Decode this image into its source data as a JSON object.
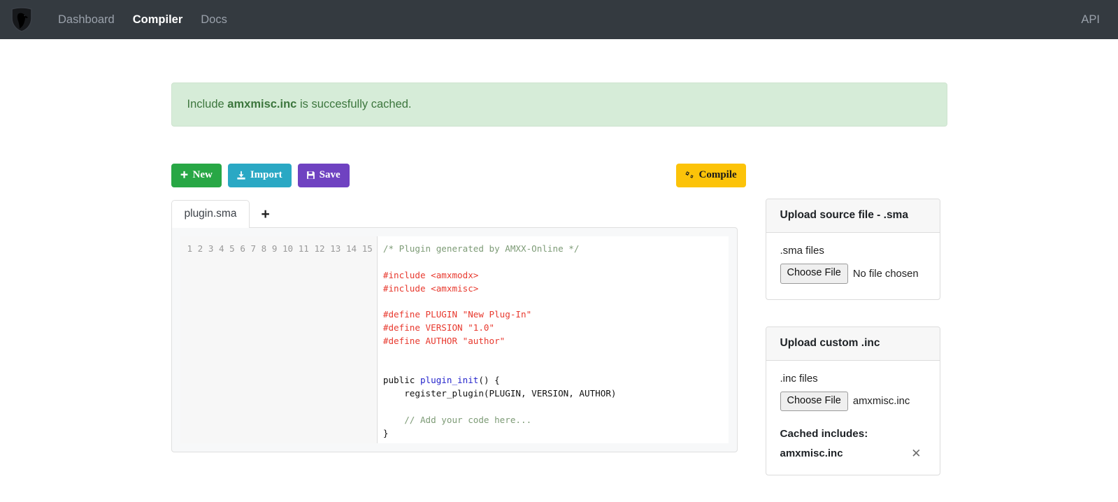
{
  "navbar": {
    "logo_name": "shield-horse-logo",
    "links": [
      {
        "label": "Dashboard",
        "active": false
      },
      {
        "label": "Compiler",
        "active": true
      },
      {
        "label": "Docs",
        "active": false
      }
    ],
    "right_link": "API"
  },
  "alert": {
    "prefix": "Include ",
    "strong": "amxmisc.inc",
    "suffix": " is succesfully cached.",
    "bg_color": "#d6ecd8",
    "text_color": "#3c763d"
  },
  "toolbar": {
    "new_label": "New",
    "import_label": "Import",
    "save_label": "Save",
    "compile_label": "Compile",
    "new_color": "#28a745",
    "import_color": "#2aa8c4",
    "save_color": "#6f42c1",
    "compile_color": "#fcc309"
  },
  "editor": {
    "tabs": [
      {
        "label": "plugin.sma",
        "active": true
      }
    ],
    "add_tab_label": "+",
    "line_numbers": "1\n2\n3\n4\n5\n6\n7\n8\n9\n10\n11\n12\n13\n14\n15",
    "lines": [
      {
        "n": 1,
        "text": "/* Plugin generated by AMXX-Online */",
        "type": "comment"
      },
      {
        "n": 2,
        "text": "",
        "type": "plain"
      },
      {
        "n": 3,
        "text": "#include <amxmodx>",
        "type": "meta"
      },
      {
        "n": 4,
        "text": "#include <amxmisc>",
        "type": "meta"
      },
      {
        "n": 5,
        "text": "",
        "type": "plain"
      },
      {
        "n": 6,
        "text": "#define PLUGIN \"New Plug-In\"",
        "type": "meta"
      },
      {
        "n": 7,
        "text": "#define VERSION \"1.0\"",
        "type": "meta"
      },
      {
        "n": 8,
        "text": "#define AUTHOR \"author\"",
        "type": "meta"
      },
      {
        "n": 9,
        "text": "",
        "type": "plain"
      },
      {
        "n": 10,
        "text": "",
        "type": "plain"
      },
      {
        "n": 11,
        "text": "public plugin_init() {",
        "type": "mixed-def"
      },
      {
        "n": 12,
        "text": "    register_plugin(PLUGIN, VERSION, AUTHOR)",
        "type": "plain"
      },
      {
        "n": 13,
        "text": "",
        "type": "plain"
      },
      {
        "n": 14,
        "text": "    // Add your code here...",
        "type": "comment"
      },
      {
        "n": 15,
        "text": "}",
        "type": "plain"
      }
    ],
    "code_l1": "/* Plugin generated by AMXX-Online */",
    "code_l3": "#include <amxmodx>",
    "code_l4": "#include <amxmisc>",
    "code_l6": "#define PLUGIN \"New Plug-In\"",
    "code_l7": "#define VERSION \"1.0\"",
    "code_l8": "#define AUTHOR \"author\"",
    "code_l11_kw": "public ",
    "code_l11_fn": "plugin_init",
    "code_l11_tail": "() {",
    "code_l12": "    register_plugin(PLUGIN, VERSION, AUTHOR)",
    "code_l14": "    // Add your code here...",
    "code_l15": "}"
  },
  "sidebar": {
    "upload_sma": {
      "title": "Upload source file - .sma",
      "file_label": ".sma files",
      "choose_button": "Choose File",
      "file_status": "No file chosen"
    },
    "upload_inc": {
      "title": "Upload custom .inc",
      "file_label": ".inc files",
      "choose_button": "Choose File",
      "file_status": "amxmisc.inc",
      "cached_title": "Cached includes:",
      "cached_items": [
        {
          "name": "amxmisc.inc",
          "remove": "✕"
        }
      ]
    }
  }
}
